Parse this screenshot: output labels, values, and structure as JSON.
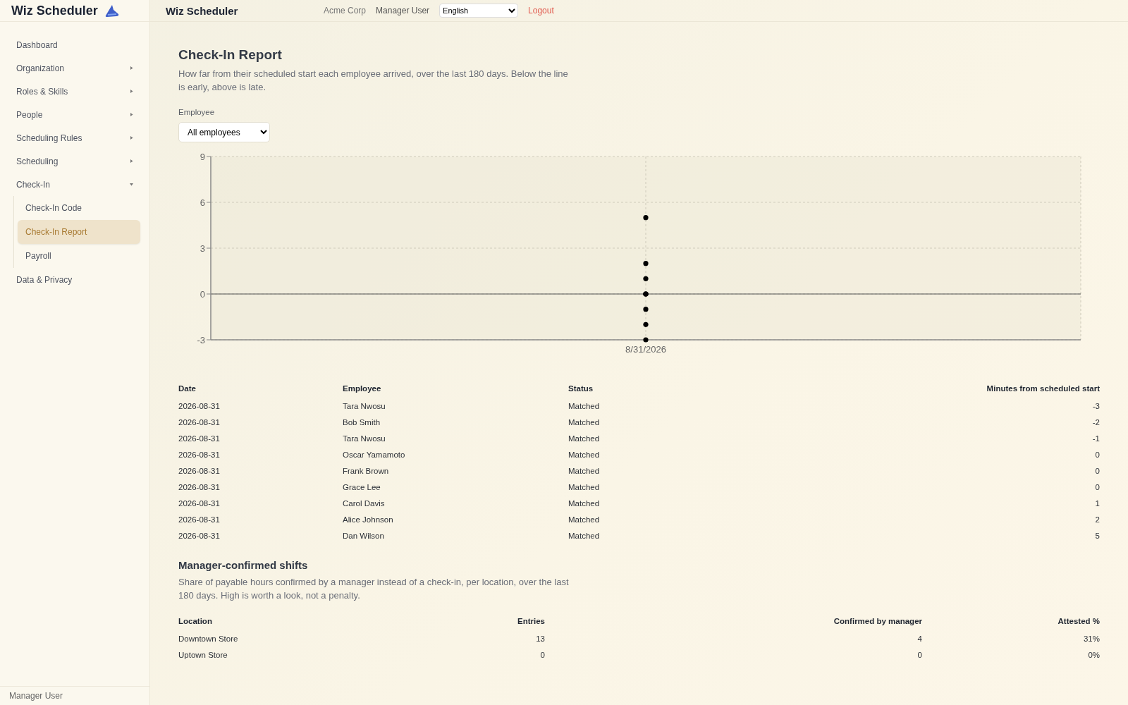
{
  "sidebar": {
    "brand": "Wiz Scheduler",
    "items": [
      {
        "label": "Dashboard",
        "kind": "link",
        "selected": false
      },
      {
        "label": "Organization",
        "kind": "group",
        "expanded": false,
        "selected": false
      },
      {
        "label": "Roles & Skills",
        "kind": "group",
        "expanded": false,
        "selected": false
      },
      {
        "label": "People",
        "kind": "group",
        "expanded": false,
        "selected": false
      },
      {
        "label": "Scheduling Rules",
        "kind": "group",
        "expanded": false,
        "selected": false
      },
      {
        "label": "Scheduling",
        "kind": "group",
        "expanded": false,
        "selected": false
      },
      {
        "label": "Check-In",
        "kind": "group",
        "expanded": true,
        "selected": false,
        "children": [
          {
            "label": "Check-In Code",
            "selected": false
          },
          {
            "label": "Check-In Report",
            "selected": true
          },
          {
            "label": "Payroll",
            "selected": false
          }
        ]
      },
      {
        "label": "Data & Privacy",
        "kind": "link",
        "selected": false
      }
    ],
    "footer_user": "Manager User"
  },
  "topbar": {
    "title": "Wiz Scheduler",
    "org": "Acme Corp",
    "user": "Manager User",
    "language": "English",
    "logout": "Logout"
  },
  "report": {
    "title": "Check-In Report",
    "description": "How far from their scheduled start each employee arrived, over the last 180 days. Below the line is early, above is late.",
    "filter": {
      "label": "Employee",
      "value": "All employees"
    },
    "chart_data": {
      "type": "scatter",
      "categories": [
        "8/31/2026"
      ],
      "series": [
        {
          "color": "#000000",
          "values": [
            -3
          ]
        },
        {
          "color": "#000000",
          "values": [
            -2
          ]
        },
        {
          "color": "#000000",
          "values": [
            -1
          ]
        },
        {
          "color": "#000000",
          "values": [
            0
          ]
        },
        {
          "color": "#000000",
          "values": [
            0
          ]
        },
        {
          "color": "#000000",
          "values": [
            0
          ]
        },
        {
          "color": "#000000",
          "values": [
            1
          ]
        },
        {
          "color": "#000000",
          "values": [
            2
          ]
        },
        {
          "color": "#000000",
          "values": [
            5
          ]
        }
      ],
      "ylim": [
        -3,
        9
      ],
      "yticks": [
        -3,
        0,
        3,
        6,
        9
      ],
      "grid": true
    },
    "table": {
      "columns": [
        "Date",
        "Employee",
        "Status",
        "Minutes from scheduled start"
      ],
      "rows": [
        [
          "2026-08-31",
          "Tara Nwosu",
          "Matched",
          "-3"
        ],
        [
          "2026-08-31",
          "Bob Smith",
          "Matched",
          "-2"
        ],
        [
          "2026-08-31",
          "Tara Nwosu",
          "Matched",
          "-1"
        ],
        [
          "2026-08-31",
          "Oscar Yamamoto",
          "Matched",
          "0"
        ],
        [
          "2026-08-31",
          "Frank Brown",
          "Matched",
          "0"
        ],
        [
          "2026-08-31",
          "Grace Lee",
          "Matched",
          "0"
        ],
        [
          "2026-08-31",
          "Carol Davis",
          "Matched",
          "1"
        ],
        [
          "2026-08-31",
          "Alice Johnson",
          "Matched",
          "2"
        ],
        [
          "2026-08-31",
          "Dan Wilson",
          "Matched",
          "5"
        ]
      ]
    }
  },
  "confirmed": {
    "title": "Manager-confirmed shifts",
    "description": "Share of payable hours confirmed by a manager instead of a check-in, per location, over the last 180 days. High is worth a look, not a penalty.",
    "table": {
      "columns": [
        "Location",
        "Entries",
        "Confirmed by manager",
        "Attested %"
      ],
      "rows": [
        [
          "Downtown Store",
          "13",
          "4",
          "31%"
        ],
        [
          "Uptown Store",
          "0",
          "0",
          "0%"
        ]
      ]
    }
  }
}
